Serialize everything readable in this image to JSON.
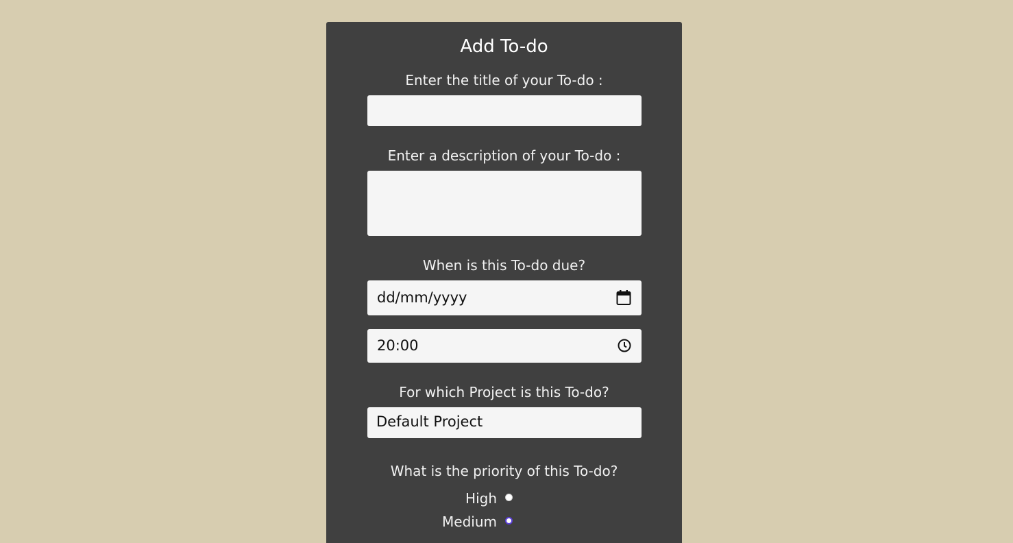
{
  "form": {
    "heading": "Add To-do",
    "title_label": "Enter the title of your To-do :",
    "title_value": "",
    "description_label": "Enter a description of your To-do :",
    "description_value": "",
    "due_label": "When is this To-do due?",
    "date_value": "dd/mm/yyyy",
    "time_value": "20:00",
    "project_label": "For which Project is this To-do?",
    "project_value": "Default Project",
    "priority_label": "What is the priority of this To-do?",
    "priorities": [
      {
        "label": "High",
        "selected": false
      },
      {
        "label": "Medium",
        "selected": true
      }
    ]
  },
  "colors": {
    "page_background": "#d7cdb0",
    "panel_background": "#404040",
    "field_background": "#f5f5f5",
    "radio_accent": "#5b3fd9"
  },
  "icons": {
    "date": "calendar-icon",
    "time": "clock-icon"
  }
}
